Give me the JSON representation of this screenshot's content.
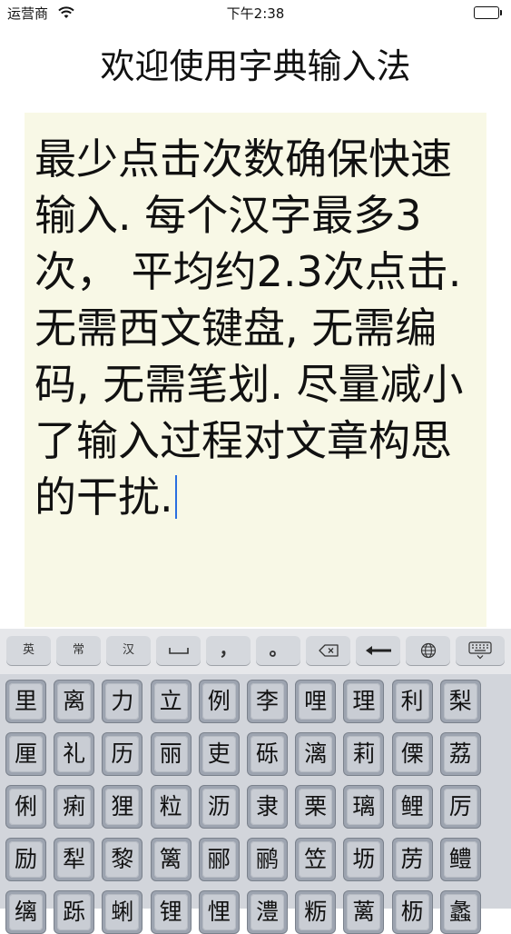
{
  "status_bar": {
    "carrier": "运营商",
    "time": "下午2:38"
  },
  "app": {
    "title": "欢迎使用字典输入法"
  },
  "editor": {
    "text": "最少点击次数确保快速输入. 每个汉字最多3次， 平均约2.3次点击. 无需西文键盘, 无需编码, 无需笔划. 尽量减小了输入过程对文章构思的干扰."
  },
  "keyboard": {
    "toolbar": {
      "english_label": "英",
      "common_label": "常",
      "chinese_label": "汉",
      "comma_label": "，",
      "period_label": "。"
    },
    "rows": [
      [
        "里",
        "离",
        "力",
        "立",
        "例",
        "李",
        "哩",
        "理",
        "利",
        "梨"
      ],
      [
        "厘",
        "礼",
        "历",
        "丽",
        "吏",
        "砾",
        "漓",
        "莉",
        "傈",
        "荔"
      ],
      [
        "俐",
        "痢",
        "狸",
        "粒",
        "沥",
        "隶",
        "栗",
        "璃",
        "鲤",
        "厉"
      ],
      [
        "励",
        "犁",
        "黎",
        "篱",
        "郦",
        "鹂",
        "笠",
        "坜",
        "苈",
        "鳢"
      ],
      [
        "缡",
        "跞",
        "蜊",
        "锂",
        "悝",
        "澧",
        "粝",
        "蓠",
        "枥",
        "蠡"
      ]
    ]
  }
}
